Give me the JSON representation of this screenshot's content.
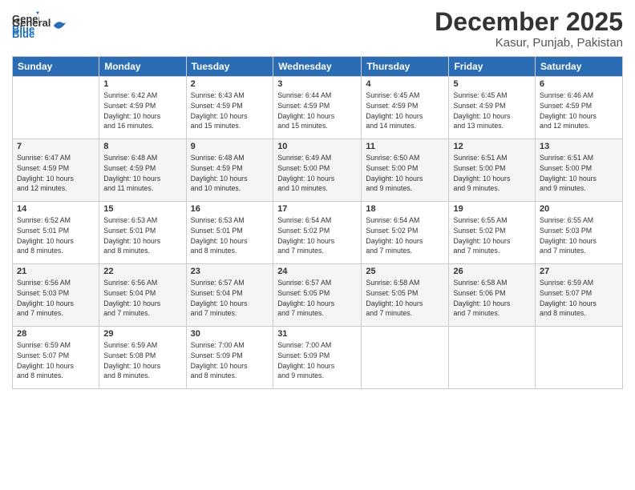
{
  "logo": {
    "line1": "General",
    "line2": "Blue"
  },
  "title": "December 2025",
  "subtitle": "Kasur, Punjab, Pakistan",
  "days_header": [
    "Sunday",
    "Monday",
    "Tuesday",
    "Wednesday",
    "Thursday",
    "Friday",
    "Saturday"
  ],
  "weeks": [
    [
      {
        "day": "",
        "info": ""
      },
      {
        "day": "1",
        "info": "Sunrise: 6:42 AM\nSunset: 4:59 PM\nDaylight: 10 hours\nand 16 minutes."
      },
      {
        "day": "2",
        "info": "Sunrise: 6:43 AM\nSunset: 4:59 PM\nDaylight: 10 hours\nand 15 minutes."
      },
      {
        "day": "3",
        "info": "Sunrise: 6:44 AM\nSunset: 4:59 PM\nDaylight: 10 hours\nand 15 minutes."
      },
      {
        "day": "4",
        "info": "Sunrise: 6:45 AM\nSunset: 4:59 PM\nDaylight: 10 hours\nand 14 minutes."
      },
      {
        "day": "5",
        "info": "Sunrise: 6:45 AM\nSunset: 4:59 PM\nDaylight: 10 hours\nand 13 minutes."
      },
      {
        "day": "6",
        "info": "Sunrise: 6:46 AM\nSunset: 4:59 PM\nDaylight: 10 hours\nand 12 minutes."
      }
    ],
    [
      {
        "day": "7",
        "info": "Sunrise: 6:47 AM\nSunset: 4:59 PM\nDaylight: 10 hours\nand 12 minutes."
      },
      {
        "day": "8",
        "info": "Sunrise: 6:48 AM\nSunset: 4:59 PM\nDaylight: 10 hours\nand 11 minutes."
      },
      {
        "day": "9",
        "info": "Sunrise: 6:48 AM\nSunset: 4:59 PM\nDaylight: 10 hours\nand 10 minutes."
      },
      {
        "day": "10",
        "info": "Sunrise: 6:49 AM\nSunset: 5:00 PM\nDaylight: 10 hours\nand 10 minutes."
      },
      {
        "day": "11",
        "info": "Sunrise: 6:50 AM\nSunset: 5:00 PM\nDaylight: 10 hours\nand 9 minutes."
      },
      {
        "day": "12",
        "info": "Sunrise: 6:51 AM\nSunset: 5:00 PM\nDaylight: 10 hours\nand 9 minutes."
      },
      {
        "day": "13",
        "info": "Sunrise: 6:51 AM\nSunset: 5:00 PM\nDaylight: 10 hours\nand 9 minutes."
      }
    ],
    [
      {
        "day": "14",
        "info": "Sunrise: 6:52 AM\nSunset: 5:01 PM\nDaylight: 10 hours\nand 8 minutes."
      },
      {
        "day": "15",
        "info": "Sunrise: 6:53 AM\nSunset: 5:01 PM\nDaylight: 10 hours\nand 8 minutes."
      },
      {
        "day": "16",
        "info": "Sunrise: 6:53 AM\nSunset: 5:01 PM\nDaylight: 10 hours\nand 8 minutes."
      },
      {
        "day": "17",
        "info": "Sunrise: 6:54 AM\nSunset: 5:02 PM\nDaylight: 10 hours\nand 7 minutes."
      },
      {
        "day": "18",
        "info": "Sunrise: 6:54 AM\nSunset: 5:02 PM\nDaylight: 10 hours\nand 7 minutes."
      },
      {
        "day": "19",
        "info": "Sunrise: 6:55 AM\nSunset: 5:02 PM\nDaylight: 10 hours\nand 7 minutes."
      },
      {
        "day": "20",
        "info": "Sunrise: 6:55 AM\nSunset: 5:03 PM\nDaylight: 10 hours\nand 7 minutes."
      }
    ],
    [
      {
        "day": "21",
        "info": "Sunrise: 6:56 AM\nSunset: 5:03 PM\nDaylight: 10 hours\nand 7 minutes."
      },
      {
        "day": "22",
        "info": "Sunrise: 6:56 AM\nSunset: 5:04 PM\nDaylight: 10 hours\nand 7 minutes."
      },
      {
        "day": "23",
        "info": "Sunrise: 6:57 AM\nSunset: 5:04 PM\nDaylight: 10 hours\nand 7 minutes."
      },
      {
        "day": "24",
        "info": "Sunrise: 6:57 AM\nSunset: 5:05 PM\nDaylight: 10 hours\nand 7 minutes."
      },
      {
        "day": "25",
        "info": "Sunrise: 6:58 AM\nSunset: 5:05 PM\nDaylight: 10 hours\nand 7 minutes."
      },
      {
        "day": "26",
        "info": "Sunrise: 6:58 AM\nSunset: 5:06 PM\nDaylight: 10 hours\nand 7 minutes."
      },
      {
        "day": "27",
        "info": "Sunrise: 6:59 AM\nSunset: 5:07 PM\nDaylight: 10 hours\nand 8 minutes."
      }
    ],
    [
      {
        "day": "28",
        "info": "Sunrise: 6:59 AM\nSunset: 5:07 PM\nDaylight: 10 hours\nand 8 minutes."
      },
      {
        "day": "29",
        "info": "Sunrise: 6:59 AM\nSunset: 5:08 PM\nDaylight: 10 hours\nand 8 minutes."
      },
      {
        "day": "30",
        "info": "Sunrise: 7:00 AM\nSunset: 5:09 PM\nDaylight: 10 hours\nand 8 minutes."
      },
      {
        "day": "31",
        "info": "Sunrise: 7:00 AM\nSunset: 5:09 PM\nDaylight: 10 hours\nand 9 minutes."
      },
      {
        "day": "",
        "info": ""
      },
      {
        "day": "",
        "info": ""
      },
      {
        "day": "",
        "info": ""
      }
    ]
  ]
}
